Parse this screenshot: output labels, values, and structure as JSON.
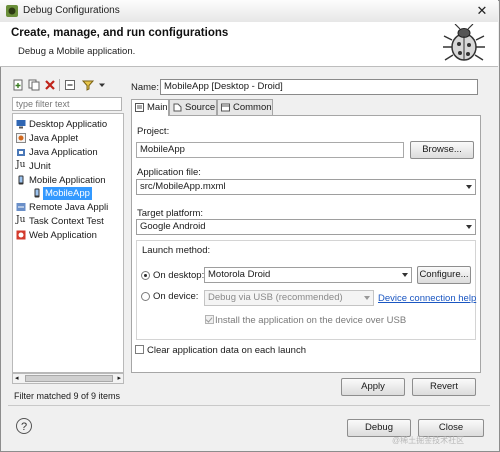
{
  "window": {
    "title": "Debug Configurations",
    "close_glyph": "✕"
  },
  "header": {
    "title": "Create, manage, and run configurations",
    "subtitle": "Debug a Mobile application.",
    "icon": "bug-icon"
  },
  "left": {
    "toolbar_icons": [
      "new-config-icon",
      "duplicate-icon",
      "delete-icon",
      "collapse-all-icon",
      "filter-icon",
      "dropdown-arrow-icon"
    ],
    "filter_placeholder": "type filter text",
    "tree": [
      {
        "label": "Desktop Applicatio",
        "icon": "desktop-app-icon",
        "level": 0
      },
      {
        "label": "Java Applet",
        "icon": "java-applet-icon",
        "level": 0
      },
      {
        "label": "Java Application",
        "icon": "java-app-icon",
        "level": 0
      },
      {
        "label": "JUnit",
        "icon": "junit-icon",
        "level": 0,
        "prefix": "Ju"
      },
      {
        "label": "Mobile Application",
        "icon": "mobile-app-icon",
        "level": 0
      },
      {
        "label": "MobileApp",
        "icon": "mobile-config-icon",
        "level": 1,
        "selected": true
      },
      {
        "label": "Remote Java Appli",
        "icon": "remote-java-icon",
        "level": 0
      },
      {
        "label": "Task Context Test",
        "icon": "task-context-icon",
        "level": 0,
        "prefix": "Ju"
      },
      {
        "label": "Web Application",
        "icon": "web-app-icon",
        "level": 0
      }
    ],
    "filter_status": "Filter matched 9 of 9 items"
  },
  "form": {
    "name_label": "Name:",
    "name_value": "MobileApp [Desktop - Droid]",
    "tabs": [
      {
        "label": "Main",
        "icon": "main-tab-icon",
        "active": true
      },
      {
        "label": "Source",
        "icon": "source-tab-icon",
        "active": false
      },
      {
        "label": "Common",
        "icon": "common-tab-icon",
        "active": false
      }
    ],
    "project_label": "Project:",
    "project_value": "MobileApp",
    "browse_label": "Browse...",
    "app_file_label": "Application file:",
    "app_file_value": "src/MobileApp.mxml",
    "platform_label": "Target platform:",
    "platform_value": "Google Android",
    "launch_method_label": "Launch method:",
    "on_desktop_label": "On desktop:",
    "on_desktop_selected": true,
    "desktop_device_value": "Motorola Droid",
    "configure_label": "Configure...",
    "on_device_label": "On device:",
    "device_mode_value": "Debug via USB (recommended)",
    "device_connection_help": "Device connection help",
    "install_label": "Install the application on the device over USB",
    "install_checked": true,
    "clear_data_label": "Clear application data on each launch",
    "clear_data_checked": false,
    "apply_label": "Apply",
    "revert_label": "Revert"
  },
  "footer": {
    "help_glyph": "?",
    "debug_label": "Debug",
    "close_label": "Close"
  },
  "watermark": "@稀土掘金技术社区"
}
